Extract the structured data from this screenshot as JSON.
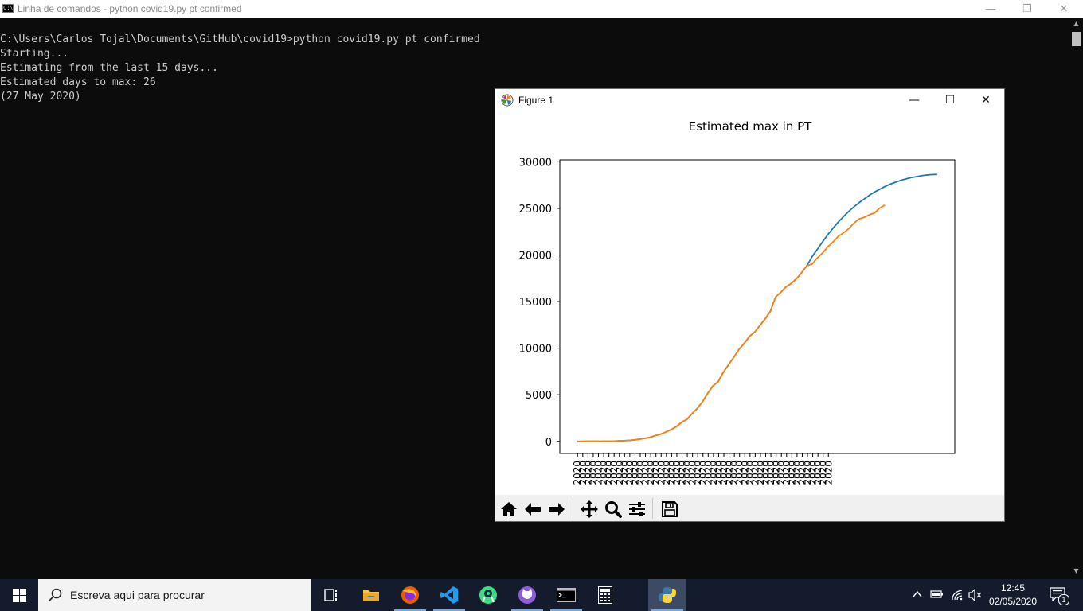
{
  "console": {
    "title": "Linha de comandos - python  covid19.py pt confirmed",
    "lines": "C:\\Users\\Carlos Tojal\\Documents\\GitHub\\covid19>python covid19.py pt confirmed\nStarting...\nEstimating from the last 15 days...\nEstimated days to max: 26\n(27 May 2020)",
    "minimize": "—",
    "restore": "❐",
    "close": "✕"
  },
  "figure": {
    "title": "Figure 1",
    "minimize": "—",
    "maximize": "☐",
    "close": "✕",
    "toolbar": [
      "home-icon",
      "back-arrow-icon",
      "forward-arrow-icon",
      "pan-icon",
      "zoom-icon",
      "configure-subplots-icon",
      "save-icon"
    ]
  },
  "chart_data": {
    "type": "line",
    "title": "Estimated max in PT",
    "xlabel": "",
    "ylabel": "",
    "ylim": [
      -1300,
      30200
    ],
    "yticks": [
      0,
      5000,
      10000,
      15000,
      20000,
      25000,
      30000
    ],
    "xtick_label": "2020",
    "xtick_count": 49,
    "grid": false,
    "series": [
      {
        "color": "#1f77b4",
        "points": [
          [
            0,
            0
          ],
          [
            1,
            0
          ],
          [
            2,
            2
          ],
          [
            3,
            4
          ],
          [
            4,
            6
          ],
          [
            5,
            13
          ],
          [
            6,
            20
          ],
          [
            7,
            30
          ],
          [
            8,
            59
          ],
          [
            9,
            78
          ],
          [
            10,
            112
          ],
          [
            11,
            169
          ],
          [
            12,
            245
          ],
          [
            13,
            331
          ],
          [
            14,
            448
          ],
          [
            15,
            642
          ],
          [
            16,
            785
          ],
          [
            17,
            1020
          ],
          [
            18,
            1280
          ],
          [
            19,
            1600
          ],
          [
            20,
            2060
          ],
          [
            21,
            2362
          ],
          [
            22,
            2995
          ],
          [
            23,
            3544
          ],
          [
            24,
            4268
          ],
          [
            25,
            5170
          ],
          [
            26,
            5962
          ],
          [
            27,
            6408
          ],
          [
            28,
            7443
          ],
          [
            29,
            8251
          ],
          [
            30,
            9034
          ],
          [
            31,
            9886
          ],
          [
            32,
            10524
          ],
          [
            33,
            11278
          ],
          [
            34,
            11730
          ],
          [
            35,
            12442
          ],
          [
            36,
            13141
          ],
          [
            37,
            13956
          ],
          [
            38,
            15472
          ],
          [
            39,
            15987
          ],
          [
            40,
            16585
          ],
          [
            41,
            16934
          ],
          [
            42,
            17448
          ],
          [
            43,
            18091
          ],
          [
            44,
            18841
          ],
          [
            45,
            19800
          ],
          [
            46,
            20600
          ],
          [
            47,
            21400
          ],
          [
            48,
            22150
          ],
          [
            49,
            22850
          ],
          [
            50,
            23500
          ],
          [
            51,
            24100
          ],
          [
            52,
            24650
          ],
          [
            53,
            25150
          ],
          [
            54,
            25600
          ],
          [
            55,
            26000
          ],
          [
            56,
            26400
          ],
          [
            57,
            26750
          ],
          [
            58,
            27050
          ],
          [
            59,
            27350
          ],
          [
            60,
            27600
          ],
          [
            61,
            27800
          ],
          [
            62,
            28000
          ],
          [
            63,
            28150
          ],
          [
            64,
            28300
          ],
          [
            65,
            28400
          ],
          [
            66,
            28500
          ],
          [
            67,
            28580
          ],
          [
            68,
            28620
          ],
          [
            69,
            28650
          ]
        ]
      },
      {
        "color": "#ff7f0e",
        "points": [
          [
            0,
            0
          ],
          [
            1,
            0
          ],
          [
            2,
            2
          ],
          [
            3,
            4
          ],
          [
            4,
            6
          ],
          [
            5,
            13
          ],
          [
            6,
            20
          ],
          [
            7,
            30
          ],
          [
            8,
            59
          ],
          [
            9,
            78
          ],
          [
            10,
            112
          ],
          [
            11,
            169
          ],
          [
            12,
            245
          ],
          [
            13,
            331
          ],
          [
            14,
            448
          ],
          [
            15,
            642
          ],
          [
            16,
            785
          ],
          [
            17,
            1020
          ],
          [
            18,
            1280
          ],
          [
            19,
            1600
          ],
          [
            20,
            2060
          ],
          [
            21,
            2362
          ],
          [
            22,
            2995
          ],
          [
            23,
            3544
          ],
          [
            24,
            4268
          ],
          [
            25,
            5170
          ],
          [
            26,
            5962
          ],
          [
            27,
            6408
          ],
          [
            28,
            7443
          ],
          [
            29,
            8251
          ],
          [
            30,
            9034
          ],
          [
            31,
            9886
          ],
          [
            32,
            10524
          ],
          [
            33,
            11278
          ],
          [
            34,
            11730
          ],
          [
            35,
            12442
          ],
          [
            36,
            13141
          ],
          [
            37,
            13956
          ],
          [
            38,
            15472
          ],
          [
            39,
            15987
          ],
          [
            40,
            16585
          ],
          [
            41,
            16934
          ],
          [
            42,
            17448
          ],
          [
            43,
            18091
          ],
          [
            44,
            18841
          ],
          [
            45,
            19022
          ],
          [
            46,
            19685
          ],
          [
            47,
            20206
          ],
          [
            48,
            20863
          ],
          [
            49,
            21379
          ],
          [
            50,
            21982
          ],
          [
            51,
            22353
          ],
          [
            52,
            22797
          ],
          [
            53,
            23392
          ],
          [
            54,
            23864
          ],
          [
            55,
            24027
          ],
          [
            56,
            24322
          ],
          [
            57,
            24505
          ],
          [
            58,
            25045
          ],
          [
            59,
            25351
          ]
        ]
      }
    ]
  },
  "taskbar": {
    "search_placeholder": "Escreva aqui para procurar",
    "apps": [
      "task-view-icon",
      "file-explorer-icon",
      "firefox-icon",
      "vscode-icon",
      "android-studio-icon",
      "github-desktop-icon",
      "terminal-icon",
      "calculator-icon",
      "python-icon"
    ],
    "time": "12:45",
    "date": "02/05/2020",
    "notification_count": "1"
  }
}
